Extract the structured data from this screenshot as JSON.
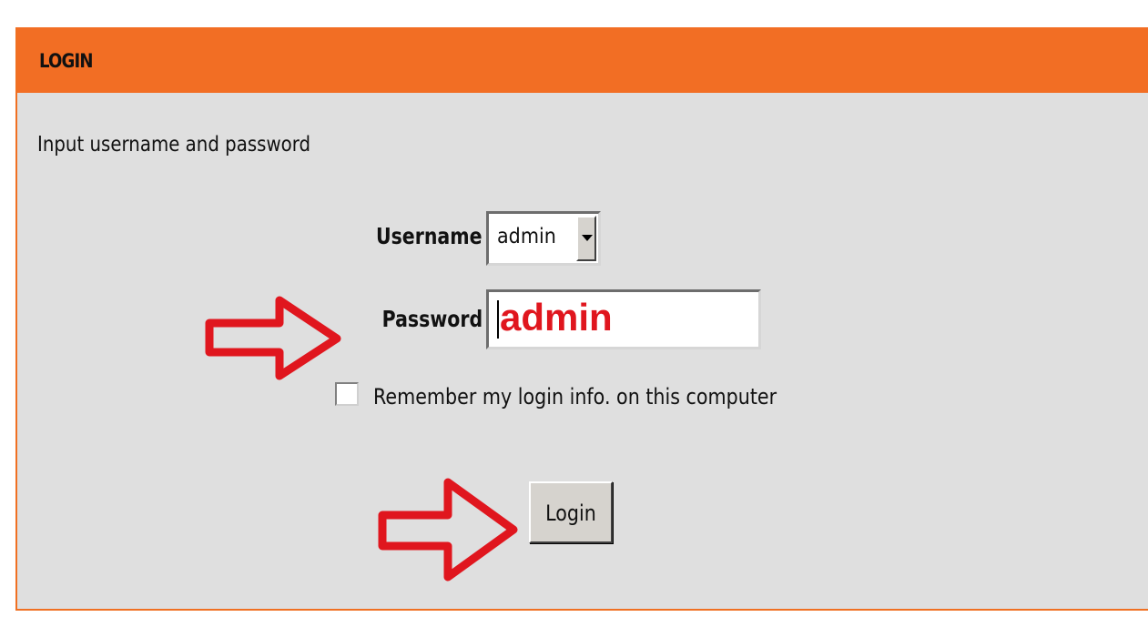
{
  "header": {
    "title": "LOGIN"
  },
  "instructions": "Input username and password",
  "form": {
    "username_label": "Username :",
    "username_value": "admin",
    "password_label": "Password :",
    "password_value": "admin",
    "remember_label": "Remember my login info. on this computer",
    "remember_checked": false,
    "login_label": "Login"
  },
  "colors": {
    "header_bg": "#f26e24",
    "panel_bg": "#dfdfdf",
    "annotation_red": "#e0161e"
  },
  "annotations": [
    {
      "icon": "red-arrow-icon",
      "points_to": "password"
    },
    {
      "icon": "red-arrow-icon",
      "points_to": "login"
    }
  ]
}
